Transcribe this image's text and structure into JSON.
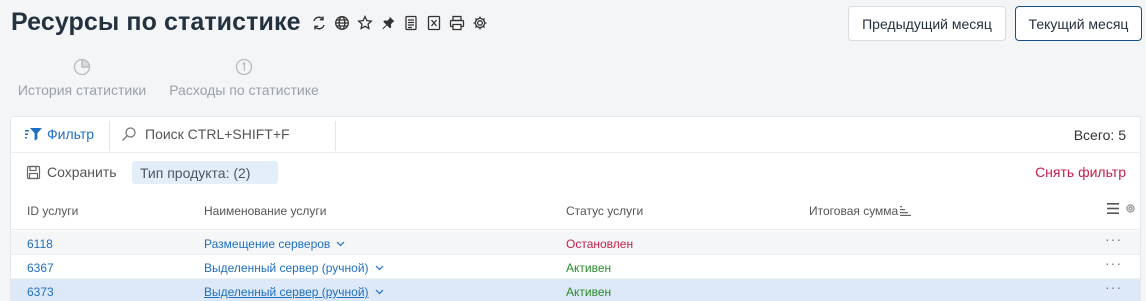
{
  "header": {
    "title": "Ресурсы по статистике",
    "icons": [
      "refresh-icon",
      "globe-icon",
      "star-icon",
      "pin-icon",
      "document-icon",
      "excel-icon",
      "print-icon",
      "settings-icon"
    ],
    "prev_month_label": "Предыдущий месяц",
    "current_month_label": "Текущий месяц"
  },
  "stat_tabs": [
    {
      "label": "История статистики",
      "icon": "pie-chart-icon"
    },
    {
      "label": "Расходы по статистике",
      "icon": "number-one-circle-icon"
    }
  ],
  "toolbar": {
    "filter_label": "Фильтр",
    "search_placeholder": "Поиск CTRL+SHIFT+F",
    "total_label": "Всего: 5"
  },
  "filter_row": {
    "save_label": "Сохранить",
    "chip_label": "Тип продукта: (2)",
    "clear_label": "Снять фильтр"
  },
  "table": {
    "columns": [
      "ID услуги",
      "Наименование услуги",
      "Статус услуги",
      "Итоговая сумма"
    ],
    "rows": [
      {
        "id": "6118",
        "name": "Размещение серверов",
        "status": "Остановлен",
        "status_type": "stopped",
        "sum": ""
      },
      {
        "id": "6367",
        "name": "Выделенный сервер (ручной)",
        "status": "Активен",
        "status_type": "active",
        "sum": ""
      },
      {
        "id": "6373",
        "name": "Выделенный сервер (ручной)",
        "status": "Активен",
        "status_type": "active",
        "sum": ""
      }
    ],
    "more_glyph": "···"
  },
  "colors": {
    "accent": "#1f6fc1",
    "danger": "#c5204a",
    "success": "#2a8a2a",
    "selected_row": "#dde9f8"
  }
}
